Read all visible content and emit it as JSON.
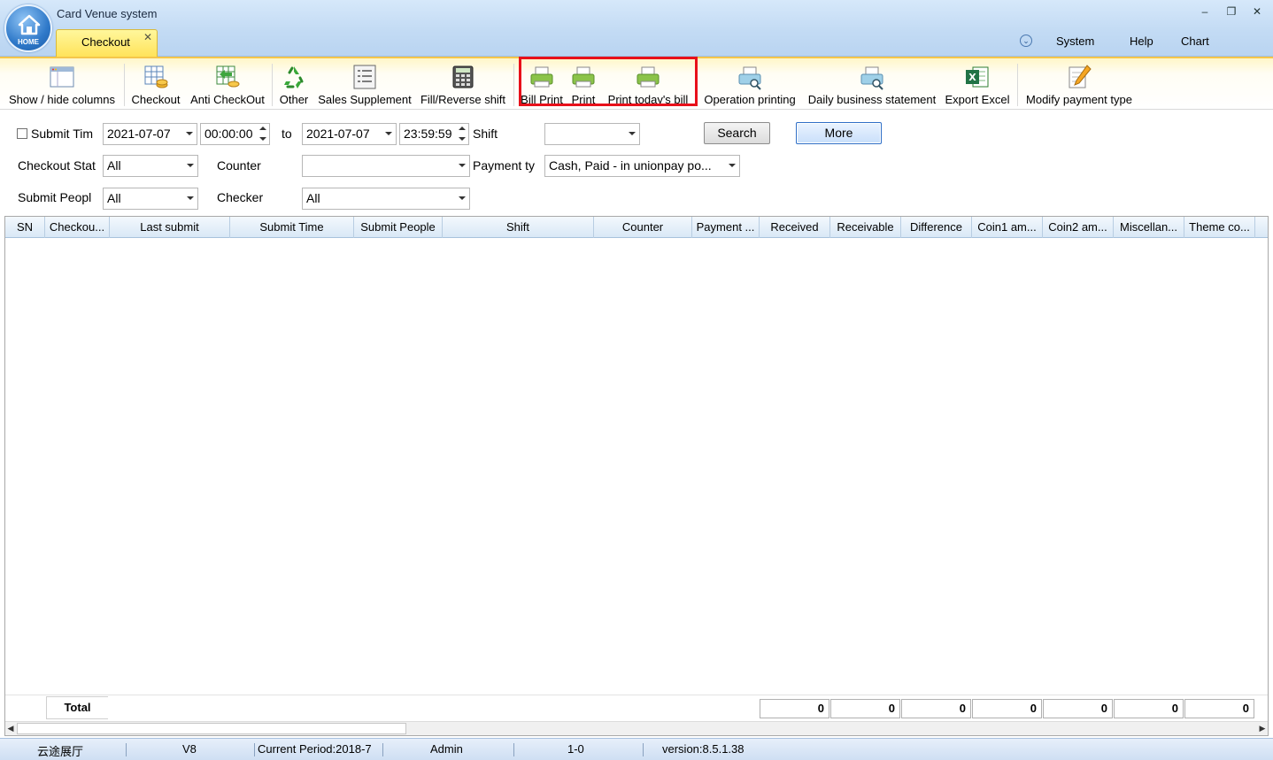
{
  "window": {
    "title": "Card Venue system",
    "logo_text": "HOME",
    "controls": [
      "–",
      "❐",
      "✕"
    ]
  },
  "tab": {
    "label": "Checkout",
    "close": "✕"
  },
  "top_menu": {
    "system": "System",
    "help": "Help",
    "chart": "Chart"
  },
  "ribbon": {
    "show_hide": "Show / hide columns",
    "checkout": "Checkout",
    "anti_checkout": "Anti CheckOut",
    "other": "Other",
    "sales_supplement": "Sales Supplement",
    "fill_reverse": "Fill/Reverse shift",
    "bill_print": "Bill Print",
    "print": "Print",
    "print_today": "Print today's bill",
    "operation_printing": "Operation printing",
    "daily_statement": "Daily business statement",
    "export_excel": "Export Excel",
    "modify_payment": "Modify payment type"
  },
  "filters": {
    "submit_time_label": "Submit Tim",
    "date_from": "2021-07-07",
    "time_from": "00:00:00",
    "to_label": "to",
    "date_to": "2021-07-07",
    "time_to": "23:59:59",
    "shift_label": "Shift",
    "shift_value": "",
    "search_button": "Search",
    "more_button": "More",
    "checkout_status_label": "Checkout Stat",
    "checkout_status_value": "All",
    "counter_label": "Counter",
    "counter_value": "",
    "payment_type_label": "Payment ty",
    "payment_type_value": "Cash, Paid - in unionpay po...",
    "submit_people_label": "Submit Peopl",
    "submit_people_value": "All",
    "checker_label": "Checker",
    "checker_value": "All"
  },
  "grid": {
    "columns": [
      "SN",
      "Checkou...",
      "Last submit",
      "Submit Time",
      "Submit People",
      "Shift",
      "Counter",
      "Payment ...",
      "Received",
      "Receivable",
      "Difference",
      "Coin1 am...",
      "Coin2 am...",
      "Miscellan...",
      "Theme co..."
    ],
    "total_label": "Total",
    "totals": [
      "0",
      "0",
      "0",
      "0",
      "0",
      "0",
      "0"
    ]
  },
  "status": {
    "venue": "云途展厅",
    "version_short": "V8",
    "period": "Current Period:2018-7",
    "user": "Admin",
    "code": "1-0",
    "version": "version:8.5.1.38"
  }
}
